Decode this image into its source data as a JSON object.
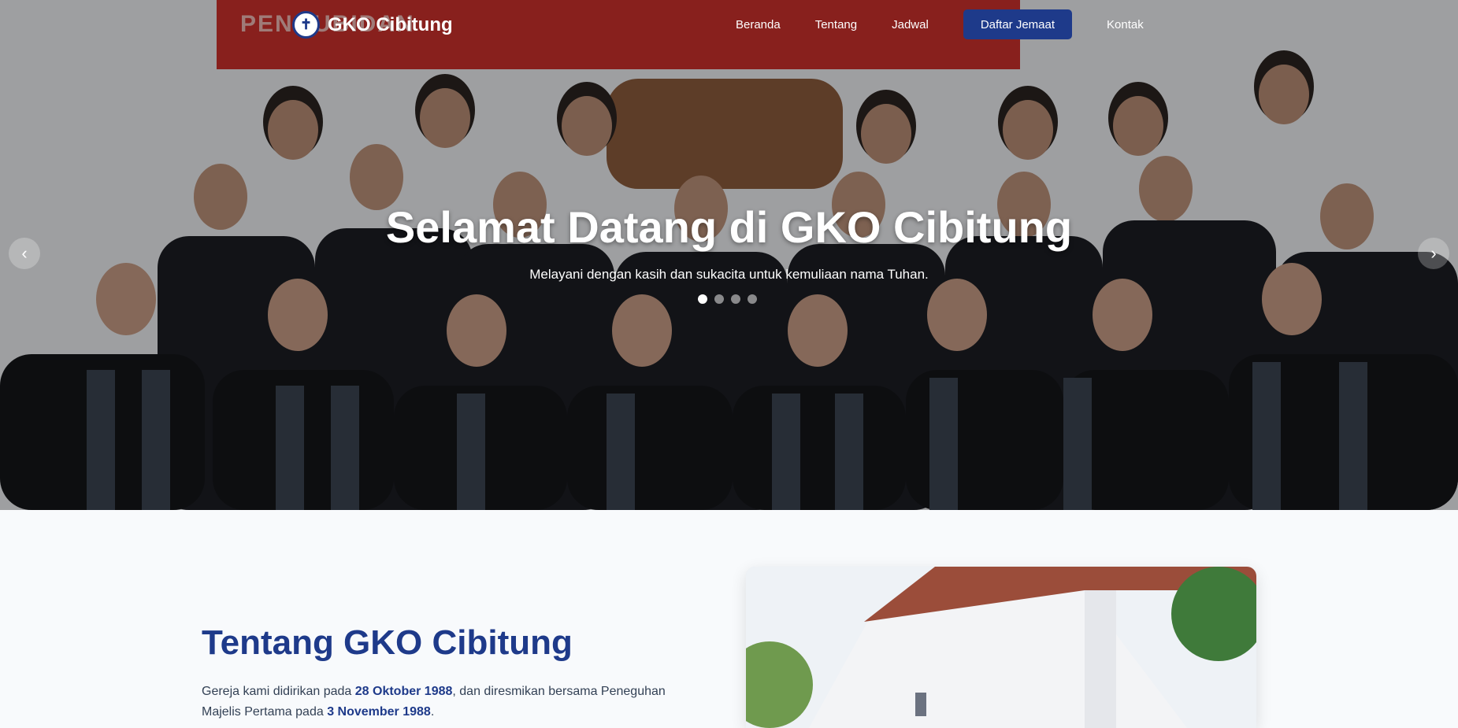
{
  "brand": {
    "name": "GKO Cibitung",
    "logo_icon": "church-logo-icon"
  },
  "nav": {
    "items": [
      {
        "label": "Beranda",
        "active": false
      },
      {
        "label": "Tentang",
        "active": false
      },
      {
        "label": "Jadwal",
        "active": false
      },
      {
        "label": "Daftar Jemaat",
        "active": true
      },
      {
        "label": "Kontak",
        "active": false
      }
    ]
  },
  "hero": {
    "title": "Selamat Datang di GKO Cibitung",
    "subtitle": "Melayani dengan kasih dan sukacita untuk kemuliaan nama Tuhan.",
    "banner_text": "PENGUBIDAN",
    "slides": 4,
    "active_slide": 0
  },
  "about": {
    "title": "Tentang GKO Cibitung",
    "text_1": "Gereja kami didirikan pada ",
    "date_1": "28 Oktober 1988",
    "text_2": ", dan diresmikan bersama Peneguhan Majelis Pertama pada ",
    "date_2": "3 November 1988",
    "text_3": "."
  },
  "colors": {
    "primary": "#1e3a8a",
    "accent": "#c9302c"
  }
}
